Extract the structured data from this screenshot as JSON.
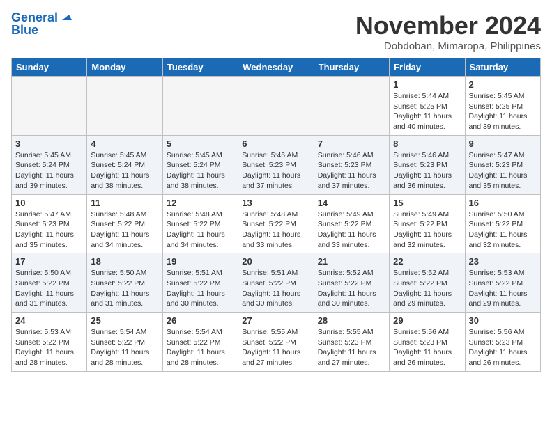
{
  "header": {
    "logo_line1": "General",
    "logo_line2": "Blue",
    "month": "November 2024",
    "location": "Dobdoban, Mimaropa, Philippines"
  },
  "days_of_week": [
    "Sunday",
    "Monday",
    "Tuesday",
    "Wednesday",
    "Thursday",
    "Friday",
    "Saturday"
  ],
  "weeks": [
    [
      {
        "day": "",
        "info": ""
      },
      {
        "day": "",
        "info": ""
      },
      {
        "day": "",
        "info": ""
      },
      {
        "day": "",
        "info": ""
      },
      {
        "day": "",
        "info": ""
      },
      {
        "day": "1",
        "info": "Sunrise: 5:44 AM\nSunset: 5:25 PM\nDaylight: 11 hours and 40 minutes."
      },
      {
        "day": "2",
        "info": "Sunrise: 5:45 AM\nSunset: 5:25 PM\nDaylight: 11 hours and 39 minutes."
      }
    ],
    [
      {
        "day": "3",
        "info": "Sunrise: 5:45 AM\nSunset: 5:24 PM\nDaylight: 11 hours and 39 minutes."
      },
      {
        "day": "4",
        "info": "Sunrise: 5:45 AM\nSunset: 5:24 PM\nDaylight: 11 hours and 38 minutes."
      },
      {
        "day": "5",
        "info": "Sunrise: 5:45 AM\nSunset: 5:24 PM\nDaylight: 11 hours and 38 minutes."
      },
      {
        "day": "6",
        "info": "Sunrise: 5:46 AM\nSunset: 5:23 PM\nDaylight: 11 hours and 37 minutes."
      },
      {
        "day": "7",
        "info": "Sunrise: 5:46 AM\nSunset: 5:23 PM\nDaylight: 11 hours and 37 minutes."
      },
      {
        "day": "8",
        "info": "Sunrise: 5:46 AM\nSunset: 5:23 PM\nDaylight: 11 hours and 36 minutes."
      },
      {
        "day": "9",
        "info": "Sunrise: 5:47 AM\nSunset: 5:23 PM\nDaylight: 11 hours and 35 minutes."
      }
    ],
    [
      {
        "day": "10",
        "info": "Sunrise: 5:47 AM\nSunset: 5:23 PM\nDaylight: 11 hours and 35 minutes."
      },
      {
        "day": "11",
        "info": "Sunrise: 5:48 AM\nSunset: 5:22 PM\nDaylight: 11 hours and 34 minutes."
      },
      {
        "day": "12",
        "info": "Sunrise: 5:48 AM\nSunset: 5:22 PM\nDaylight: 11 hours and 34 minutes."
      },
      {
        "day": "13",
        "info": "Sunrise: 5:48 AM\nSunset: 5:22 PM\nDaylight: 11 hours and 33 minutes."
      },
      {
        "day": "14",
        "info": "Sunrise: 5:49 AM\nSunset: 5:22 PM\nDaylight: 11 hours and 33 minutes."
      },
      {
        "day": "15",
        "info": "Sunrise: 5:49 AM\nSunset: 5:22 PM\nDaylight: 11 hours and 32 minutes."
      },
      {
        "day": "16",
        "info": "Sunrise: 5:50 AM\nSunset: 5:22 PM\nDaylight: 11 hours and 32 minutes."
      }
    ],
    [
      {
        "day": "17",
        "info": "Sunrise: 5:50 AM\nSunset: 5:22 PM\nDaylight: 11 hours and 31 minutes."
      },
      {
        "day": "18",
        "info": "Sunrise: 5:50 AM\nSunset: 5:22 PM\nDaylight: 11 hours and 31 minutes."
      },
      {
        "day": "19",
        "info": "Sunrise: 5:51 AM\nSunset: 5:22 PM\nDaylight: 11 hours and 30 minutes."
      },
      {
        "day": "20",
        "info": "Sunrise: 5:51 AM\nSunset: 5:22 PM\nDaylight: 11 hours and 30 minutes."
      },
      {
        "day": "21",
        "info": "Sunrise: 5:52 AM\nSunset: 5:22 PM\nDaylight: 11 hours and 30 minutes."
      },
      {
        "day": "22",
        "info": "Sunrise: 5:52 AM\nSunset: 5:22 PM\nDaylight: 11 hours and 29 minutes."
      },
      {
        "day": "23",
        "info": "Sunrise: 5:53 AM\nSunset: 5:22 PM\nDaylight: 11 hours and 29 minutes."
      }
    ],
    [
      {
        "day": "24",
        "info": "Sunrise: 5:53 AM\nSunset: 5:22 PM\nDaylight: 11 hours and 28 minutes."
      },
      {
        "day": "25",
        "info": "Sunrise: 5:54 AM\nSunset: 5:22 PM\nDaylight: 11 hours and 28 minutes."
      },
      {
        "day": "26",
        "info": "Sunrise: 5:54 AM\nSunset: 5:22 PM\nDaylight: 11 hours and 28 minutes."
      },
      {
        "day": "27",
        "info": "Sunrise: 5:55 AM\nSunset: 5:22 PM\nDaylight: 11 hours and 27 minutes."
      },
      {
        "day": "28",
        "info": "Sunrise: 5:55 AM\nSunset: 5:23 PM\nDaylight: 11 hours and 27 minutes."
      },
      {
        "day": "29",
        "info": "Sunrise: 5:56 AM\nSunset: 5:23 PM\nDaylight: 11 hours and 26 minutes."
      },
      {
        "day": "30",
        "info": "Sunrise: 5:56 AM\nSunset: 5:23 PM\nDaylight: 11 hours and 26 minutes."
      }
    ]
  ]
}
